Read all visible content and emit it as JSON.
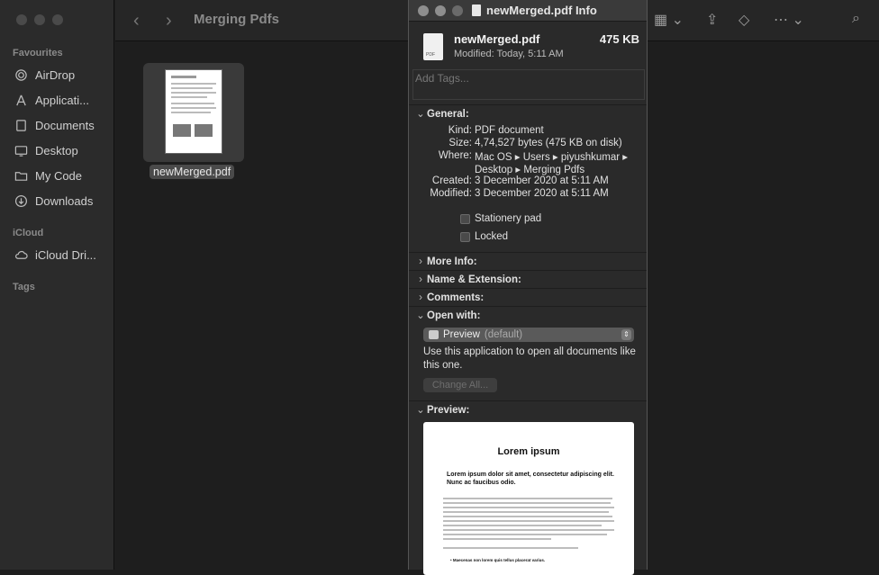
{
  "finder": {
    "title": "Merging Pdfs",
    "sidebar": {
      "favourites_label": "Favourites",
      "items": [
        {
          "label": "AirDrop",
          "icon": "airdrop-icon"
        },
        {
          "label": "Applicati...",
          "icon": "applications-icon"
        },
        {
          "label": "Documents",
          "icon": "document-icon"
        },
        {
          "label": "Desktop",
          "icon": "desktop-icon"
        },
        {
          "label": "My Code",
          "icon": "folder-icon"
        },
        {
          "label": "Downloads",
          "icon": "downloads-icon"
        }
      ],
      "icloud_label": "iCloud",
      "icloud_item": "iCloud Dri...",
      "tags_label": "Tags"
    },
    "file": {
      "name": "newMerged.pdf"
    }
  },
  "info": {
    "window_title": "newMerged.pdf Info",
    "name": "newMerged.pdf",
    "size": "475 KB",
    "modified_summary": "Modified: Today, 5:11 AM",
    "tags_placeholder": "Add Tags...",
    "sections": {
      "general": "General:",
      "more_info": "More Info:",
      "name_ext": "Name & Extension:",
      "comments": "Comments:",
      "open_with": "Open with:",
      "preview": "Preview:"
    },
    "general": {
      "kind_label": "Kind:",
      "kind": "PDF document",
      "size_label": "Size:",
      "size": "4,74,527 bytes (475 KB on disk)",
      "where_label": "Where:",
      "where_1": "Mac OS ▸ Users ▸ piyushkumar ▸",
      "where_2": "Desktop ▸ Merging Pdfs",
      "created_label": "Created:",
      "created": "3 December 2020 at 5:11 AM",
      "modified_label": "Modified:",
      "modified": "3 December 2020 at 5:11 AM",
      "stationery": "Stationery pad",
      "locked": "Locked"
    },
    "open_with": {
      "app": "Preview",
      "default": "(default)",
      "description": "Use this application to open all documents like this one.",
      "change_all": "Change All..."
    },
    "preview_doc": {
      "title": "Lorem ipsum",
      "subtitle": "Lorem ipsum dolor sit amet, consectetur adipiscing elit. Nunc ac faucibus odio.",
      "bullet": "Maecenas non lorem quis tellus placerat varius."
    }
  }
}
